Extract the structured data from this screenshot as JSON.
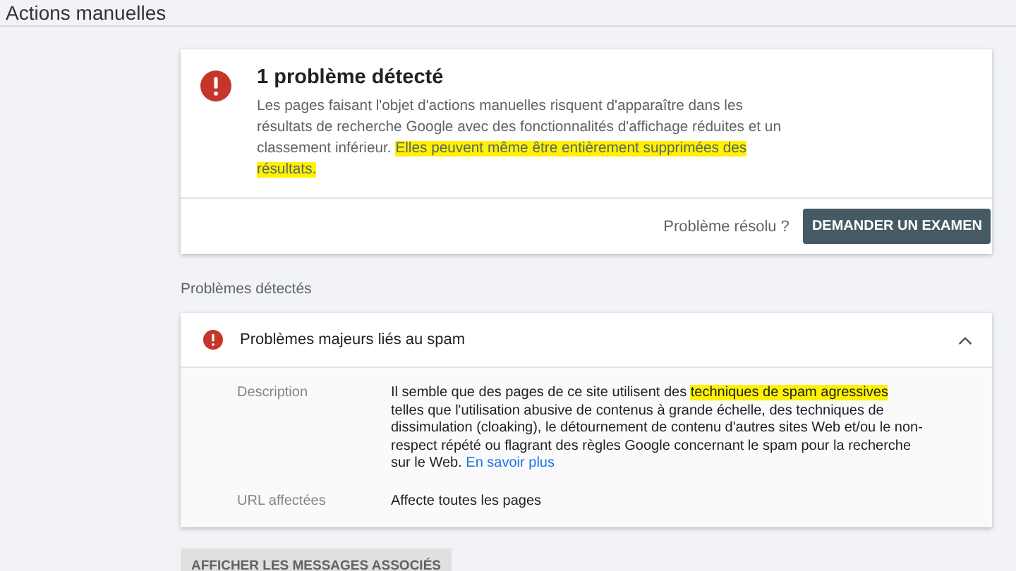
{
  "page_title": "Actions manuelles",
  "summary": {
    "title": "1 problème détecté",
    "text_before": "Les pages faisant l'objet d'actions manuelles risquent d'apparaître dans les résultats de recherche Google avec des fonctionnalités d'affichage réduites et un classement inférieur.",
    "text_highlight": "Elles peuvent même être entièrement supprimées des résultats.",
    "resolved_label": "Problème résolu ?",
    "review_button": "DEMANDER UN EXAMEN"
  },
  "section_label": "Problèmes détectés",
  "issue": {
    "title": "Problèmes majeurs liés au spam",
    "expanded": true,
    "rows": [
      {
        "kind": "description",
        "label": "Description",
        "text_before": "Il semble que des pages de ce site utilisent des",
        "text_highlight": "techniques de spam agressives",
        "text_after": "telles que l'utilisation abusive de contenus à grande échelle, des techniques de dissimulation (cloaking), le détournement de contenu d'autres sites Web et/ou le non-respect répété ou flagrant des règles Google concernant le spam pour la recherche sur le Web.",
        "link": "En savoir plus"
      },
      {
        "kind": "plain",
        "label": "URL affectées",
        "value": "Affecte toutes les pages"
      }
    ]
  },
  "messages_button": "AFFICHER LES MESSAGES ASSOCIÉS"
}
